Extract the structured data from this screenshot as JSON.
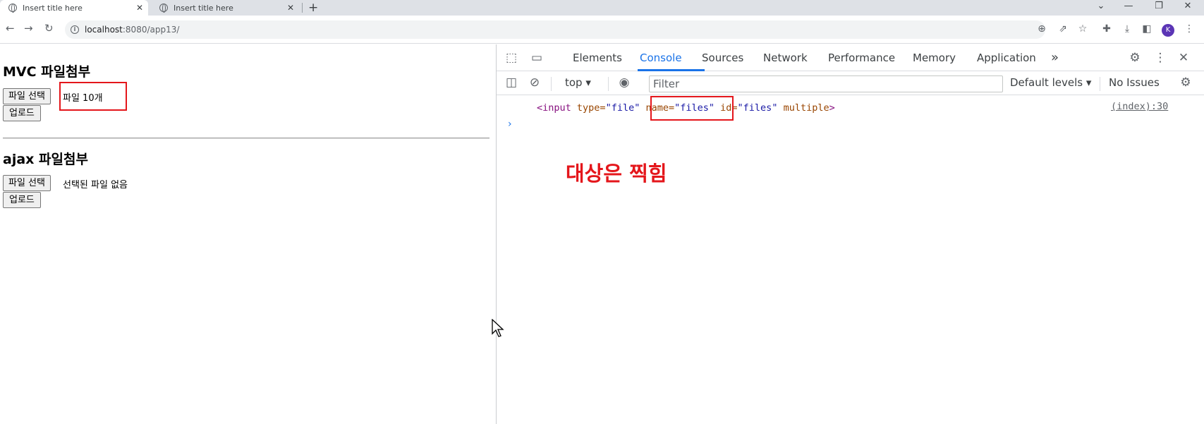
{
  "browser": {
    "tabs": [
      {
        "title": "Insert title here",
        "close": "✕",
        "active": true
      },
      {
        "title": "Insert title here",
        "close": "✕",
        "active": false
      }
    ],
    "new_tab": "+",
    "window_controls": {
      "chevron": "⌄",
      "minimize": "—",
      "restore": "❐",
      "close": "✕"
    },
    "url_host": "localhost",
    "url_path": ":8080/app13/",
    "profile_initial": "K"
  },
  "page": {
    "mvc_title": "MVC 파일첨부",
    "mvc_file_button": "파일 선택",
    "mvc_file_status": "파일 10개",
    "mvc_upload": "업로드",
    "ajax_title": "ajax 파일첨부",
    "ajax_file_button": "파일 선택",
    "ajax_file_status": "선택된 파일 없음",
    "ajax_upload": "업로드"
  },
  "devtools": {
    "tabs": [
      "Elements",
      "Console",
      "Sources",
      "Network",
      "Performance",
      "Memory",
      "Application"
    ],
    "active_tab": "Console",
    "more_tabs": "»",
    "context": "top",
    "filter_placeholder": "Filter",
    "levels": "Default levels ▾",
    "issues": "No Issues",
    "console": {
      "tag_open": "<input",
      "attr_type": " type=",
      "val_type": "\"file\"",
      "attr_name": " name=",
      "val_name": "\"files\"",
      "attr_id": " id=",
      "val_id": "\"files\"",
      "attr_multiple": " multiple",
      "tag_close": ">",
      "source": "(index):30",
      "prompt": "›"
    },
    "annotation": "대상은 찍힘"
  },
  "colors": {
    "accent": "#1a73e8",
    "annotation_red": "#e4161b",
    "avatar": "#5b35b5"
  }
}
